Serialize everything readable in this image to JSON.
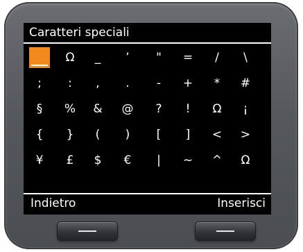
{
  "screen": {
    "title": "Caratteri speciali",
    "selected_row": 0,
    "selected_col": 0,
    "rows": [
      [
        "",
        "Ω",
        "_",
        "ʼ",
        "\"",
        "=",
        "/",
        "\\"
      ],
      [
        ";",
        ":",
        ",",
        ".",
        "-",
        "+",
        "*",
        "#"
      ],
      [
        "§",
        "%",
        "&",
        "@",
        "?",
        "!",
        "Ω",
        "¡"
      ],
      [
        "{",
        "}",
        "(",
        ")",
        "[",
        "]",
        "<",
        ">"
      ],
      [
        "¥",
        "£",
        "$",
        "€",
        "|",
        "~",
        "^",
        "Ω"
      ]
    ]
  },
  "softkeys": {
    "left_label": "Indietro",
    "right_label": "Inserisci"
  },
  "colors": {
    "selection": "#f08a1e",
    "screen_background": "#000000",
    "text": "#ffffff"
  }
}
